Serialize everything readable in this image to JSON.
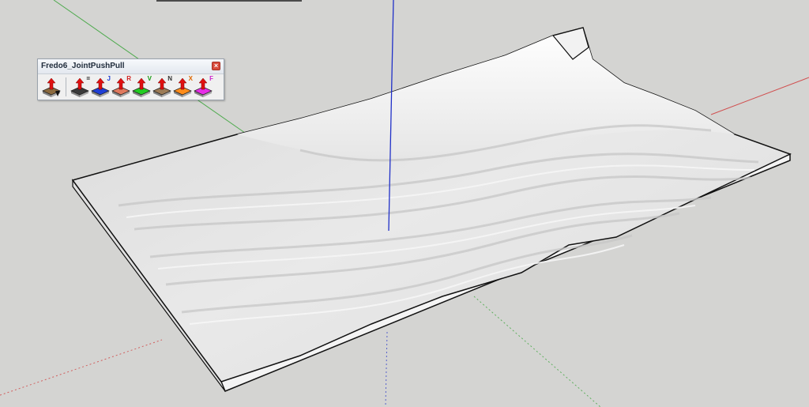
{
  "toolbar": {
    "title": "Fredo6_JointPushPull",
    "close_glyph": "×",
    "buttons": [
      {
        "name": "joint-push-pull-main",
        "icon": "push-pull-brown-icon",
        "letter": "",
        "color": "#8b6a3e",
        "letter_color": ""
      },
      {
        "name": "joint-push-pull",
        "icon": "push-pull-black-icon",
        "letter": "=",
        "color": "#3a3a3a",
        "letter_color": "#000000"
      },
      {
        "name": "vector-push-pull",
        "icon": "push-pull-blue-icon",
        "letter": "J",
        "color": "#1f3fd6",
        "letter_color": "#1f3fd6"
      },
      {
        "name": "round-push-pull",
        "icon": "push-pull-salmon-icon",
        "letter": "R",
        "color": "#e07a5f",
        "letter_color": "#d02020"
      },
      {
        "name": "volume-push-pull",
        "icon": "push-pull-green-icon",
        "letter": "V",
        "color": "#22cc22",
        "letter_color": "#119911"
      },
      {
        "name": "normal-push-pull",
        "icon": "push-pull-tan-icon",
        "letter": "N",
        "color": "#9c7b56",
        "letter_color": "#333333"
      },
      {
        "name": "extrude-push-pull",
        "icon": "push-pull-orange-icon",
        "letter": "X",
        "color": "#ff8c1a",
        "letter_color": "#dd6600"
      },
      {
        "name": "follow-push-pull",
        "icon": "push-pull-magenta-icon",
        "letter": "F",
        "color": "#e62ee6",
        "letter_color": "#cc22cc"
      }
    ]
  },
  "viewport": {
    "background": "#d4d4d2",
    "axis_colors": {
      "red": "#d03030",
      "green": "#2ea02e",
      "blue": "#2030c8"
    }
  }
}
